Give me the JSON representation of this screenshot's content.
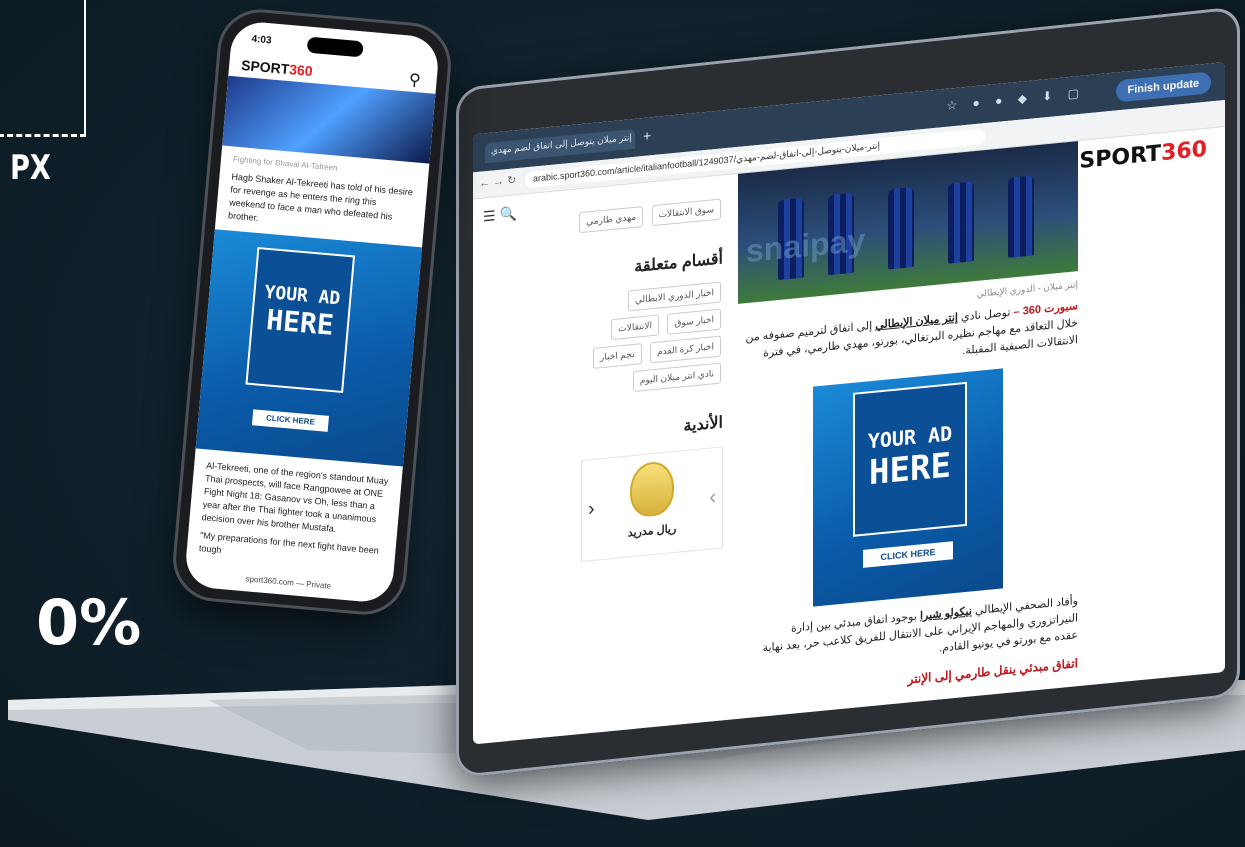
{
  "stats": {
    "unit_label": "PX",
    "percent_label": "0%"
  },
  "laptop": {
    "browser": {
      "tab_title": "إنتر ميلان يتوصل إلى اتفاق لضم مهدي",
      "url": "arabic.sport360.com/article/italianfootball/1249037/إنتر-ميلان-يتوصل-إلى-اتفاق-لضم-مهدي",
      "finish_update": "Finish update"
    },
    "site": {
      "logo_text": "SPORT",
      "logo_number": "360",
      "sidebar": {
        "top_chips": [
          "سوق الانتقالات",
          "مهدي طارمي"
        ],
        "related_title": "أقسام متعلقة",
        "related_chips": [
          "اخبار الدوري الايطالي",
          "اخبار سوق",
          "الانتقالات",
          "اخبار كرة القدم",
          "نجم اخبار",
          "نادي انتر ميلان اليوم"
        ],
        "clubs_title": "الأندية",
        "club_name": "ريال مدريد"
      },
      "article": {
        "caption": "إنتر ميلان - الدوري الإيطالي",
        "lead_source": "سبورت 360 –",
        "lead_text": "توصل نادي",
        "lead_club": "إنتر ميلان الإيطالي",
        "lead_rest": "إلى اتفاق لترميم صفوفه من خلال التعاقد مع مهاجم نظيره البرتغالي، بورتو، مهدي طارمي، في فترة الانتقالات الصيفية المقبلة.",
        "para2_start": "وأفاد الصحفي الإيطالي",
        "para2_name": "نيكولو شيرا",
        "para2_rest": "بوجود اتفاق مبدئي بين إدارة النيراتزوري والمهاجم الإيراني على الانتقال للفريق كلاعب حر، بعد نهاية عقده مع بورتو في يونيو القادم.",
        "red_link": "اتفاق مبدئي ينقل طارمي إلى الإنتر",
        "hero_text": "snaipay"
      },
      "ad": {
        "line1": "YOUR AD",
        "line2": "HERE",
        "button": "CLICK HERE"
      }
    }
  },
  "phone": {
    "time": "4:03",
    "logo_text": "SPORT",
    "logo_number": "360",
    "caption": "Fighting for Bhaval Al-Tafreen",
    "text1": "Hagb Shaker Al-Tekreeti has told of his desire for revenge as he enters the ring this weekend to face a man who defeated his brother.",
    "ad": {
      "line1": "YOUR AD",
      "line2": "HERE",
      "button": "CLICK HERE"
    },
    "text2": "Al-Tekreeti, one of the region's standout Muay Thai prospects, will face Rangpowee at ONE Fight Night 18: Gasanov vs Oh, less than a year after the Thai fighter took a unanimous decision over his brother Mustafa.",
    "text3": "\"My preparations for the next fight have been tough",
    "footer": "sport360.com — Private"
  }
}
